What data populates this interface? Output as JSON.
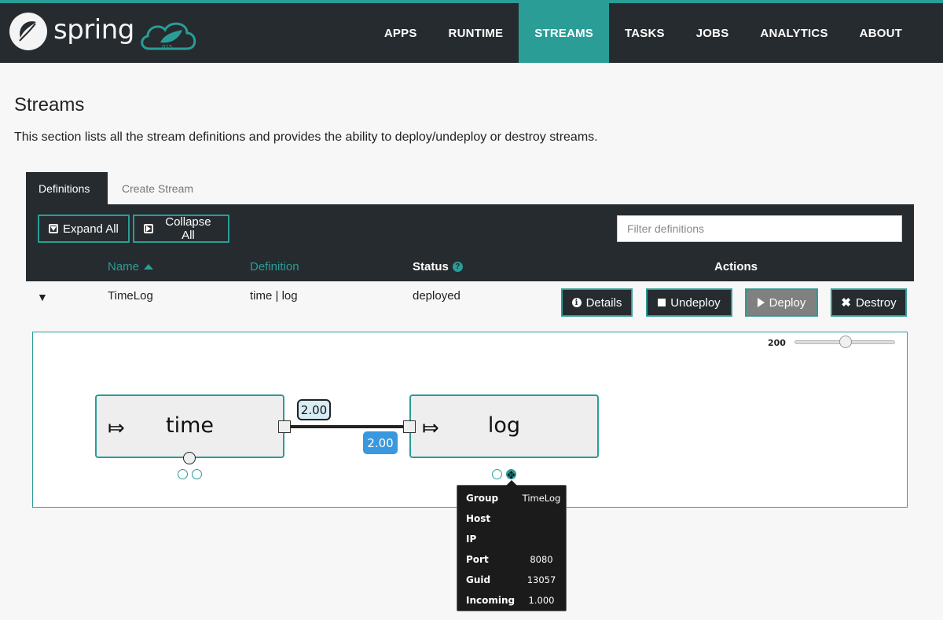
{
  "brand": {
    "name": "spring"
  },
  "nav": {
    "items": [
      {
        "label": "APPS",
        "active": false
      },
      {
        "label": "RUNTIME",
        "active": false
      },
      {
        "label": "STREAMS",
        "active": true
      },
      {
        "label": "TASKS",
        "active": false
      },
      {
        "label": "JOBS",
        "active": false
      },
      {
        "label": "ANALYTICS",
        "active": false
      },
      {
        "label": "ABOUT",
        "active": false
      }
    ]
  },
  "page": {
    "title": "Streams",
    "description": "This section lists all the stream definitions and provides the ability to deploy/undeploy or destroy streams."
  },
  "tabs": [
    {
      "label": "Definitions",
      "active": true
    },
    {
      "label": "Create Stream",
      "active": false
    }
  ],
  "toolbar": {
    "expand_all": "Expand All",
    "collapse_all": "Collapse All",
    "filter_placeholder": "Filter definitions"
  },
  "table": {
    "columns": {
      "name": "Name",
      "definition": "Definition",
      "status": "Status",
      "actions": "Actions"
    },
    "rows": [
      {
        "name": "TimeLog",
        "definition": "time | log",
        "status": "deployed",
        "expanded": true
      }
    ],
    "actions": {
      "details": "Details",
      "undeploy": "Undeploy",
      "deploy": "Deploy",
      "destroy": "Destroy"
    }
  },
  "flow": {
    "zoom": "200",
    "zoom_fraction": 0.5,
    "nodes": [
      {
        "label": "time",
        "icon": "⤇"
      },
      {
        "label": "log",
        "icon": "⤇"
      }
    ],
    "link_rates": {
      "outgoing": "2.00",
      "incoming": "2.00"
    }
  },
  "tooltip": {
    "rows": [
      {
        "key": "Group",
        "value": "TimeLog"
      },
      {
        "key": "Host",
        "value": ""
      },
      {
        "key": "IP",
        "value": ""
      },
      {
        "key": "Port",
        "value": "8080"
      },
      {
        "key": "Guid",
        "value": "13057"
      },
      {
        "key": "Incoming",
        "value": "1.000"
      }
    ]
  },
  "colors": {
    "accent": "#2a9d97",
    "dark": "#262b2f",
    "rate_badge": "#3a98de"
  }
}
